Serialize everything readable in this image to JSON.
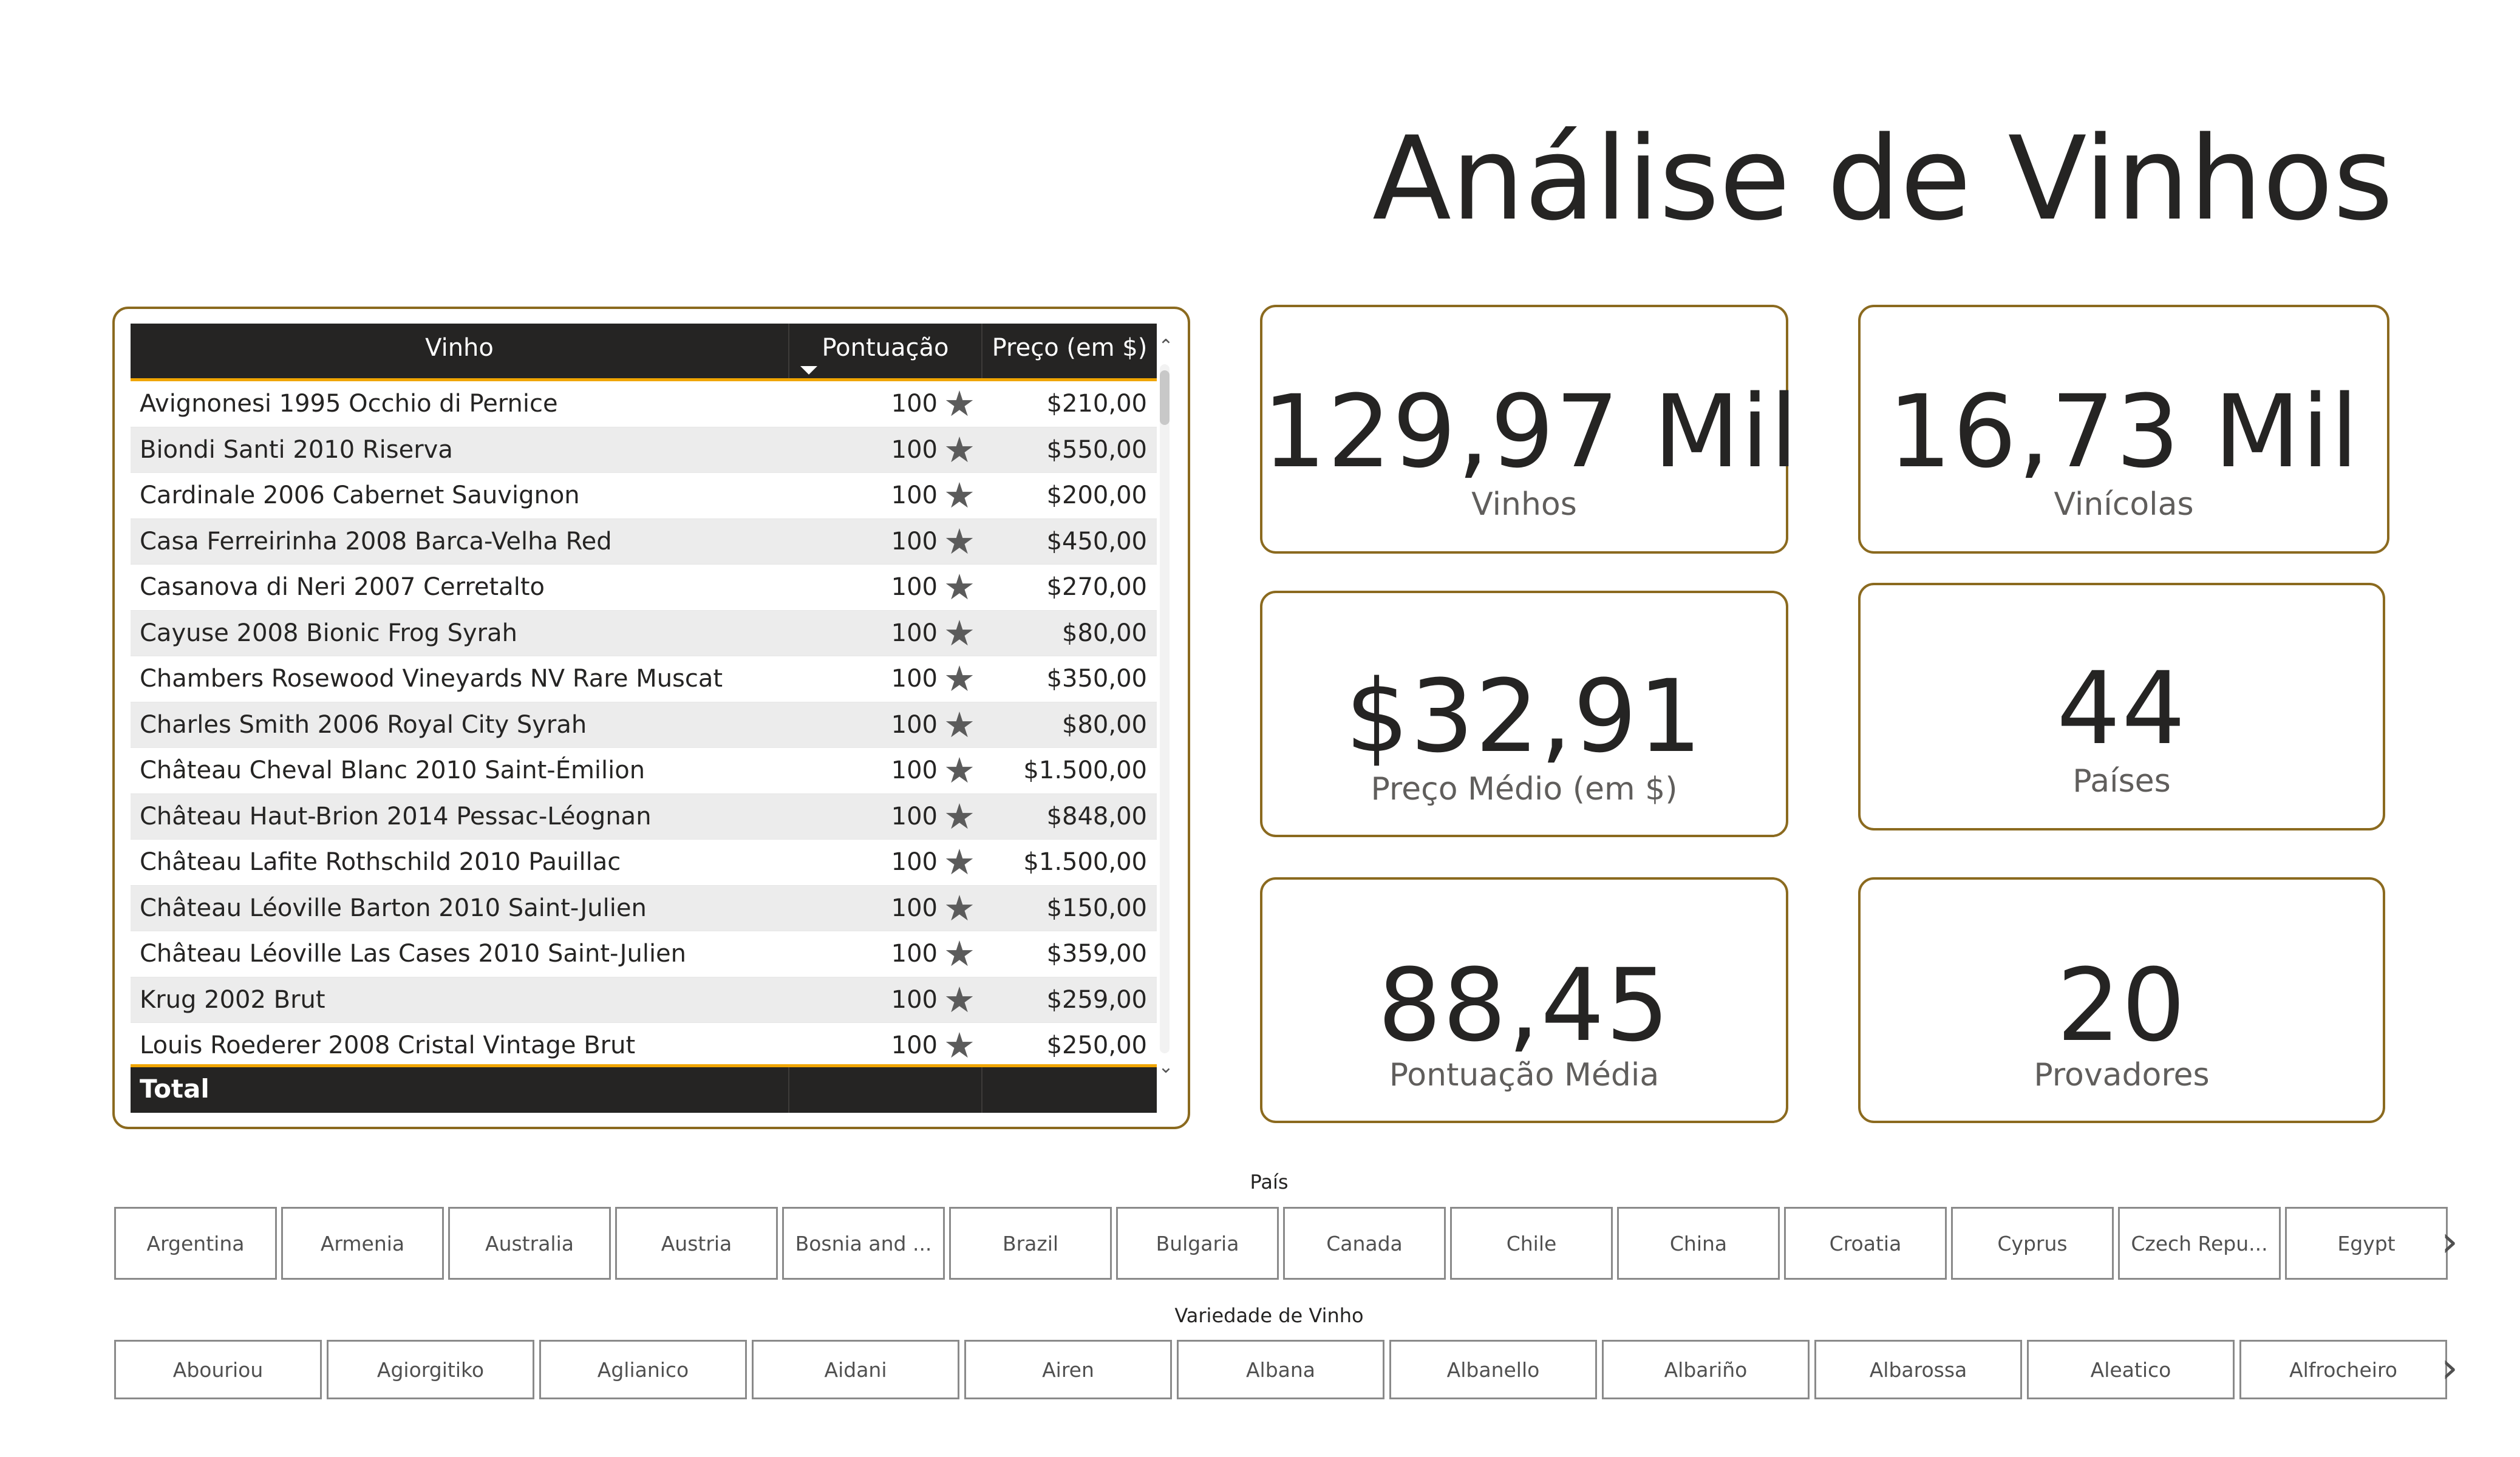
{
  "title": "Análise de Vinhos",
  "table": {
    "headers": {
      "wine": "Vinho",
      "score": "Pontuação",
      "price": "Preço (em $)"
    },
    "rows": [
      {
        "wine": "Avignonesi 1995 Occhio di Pernice",
        "score": "100",
        "price": "$210,00"
      },
      {
        "wine": "Biondi Santi 2010 Riserva",
        "score": "100",
        "price": "$550,00"
      },
      {
        "wine": "Cardinale 2006 Cabernet Sauvignon",
        "score": "100",
        "price": "$200,00"
      },
      {
        "wine": "Casa Ferreirinha 2008 Barca-Velha Red",
        "score": "100",
        "price": "$450,00"
      },
      {
        "wine": "Casanova di Neri 2007 Cerretalto",
        "score": "100",
        "price": "$270,00"
      },
      {
        "wine": "Cayuse 2008 Bionic Frog Syrah",
        "score": "100",
        "price": "$80,00"
      },
      {
        "wine": "Chambers Rosewood Vineyards NV Rare Muscat",
        "score": "100",
        "price": "$350,00"
      },
      {
        "wine": "Charles Smith 2006 Royal City Syrah",
        "score": "100",
        "price": "$80,00"
      },
      {
        "wine": "Château Cheval Blanc 2010 Saint-Émilion",
        "score": "100",
        "price": "$1.500,00"
      },
      {
        "wine": "Château Haut-Brion 2014 Pessac-Léognan",
        "score": "100",
        "price": "$848,00"
      },
      {
        "wine": "Château Lafite Rothschild 2010 Pauillac",
        "score": "100",
        "price": "$1.500,00"
      },
      {
        "wine": "Château Léoville Barton 2010 Saint-Julien",
        "score": "100",
        "price": "$150,00"
      },
      {
        "wine": "Château Léoville Las Cases 2010 Saint-Julien",
        "score": "100",
        "price": "$359,00"
      },
      {
        "wine": "Krug 2002 Brut",
        "score": "100",
        "price": "$259,00"
      },
      {
        "wine": "Louis Roederer 2008 Cristal Vintage Brut",
        "score": "100",
        "price": "$250,00"
      }
    ],
    "total_label": "Total",
    "row_icon": "star-icon"
  },
  "kpis": {
    "wines": {
      "value": "129,97 Mil",
      "label": "Vinhos"
    },
    "wineries": {
      "value": "16,73 Mil",
      "label": "Vinícolas"
    },
    "avg_price": {
      "value": "$32,91",
      "label": "Preço Médio (em $)"
    },
    "countries": {
      "value": "44",
      "label": "Países"
    },
    "avg_score": {
      "value": "88,45",
      "label": "Pontuação Média"
    },
    "tasters": {
      "value": "20",
      "label": "Provadores"
    }
  },
  "slicers": {
    "country": {
      "title": "País",
      "items": [
        "Argentina",
        "Armenia",
        "Australia",
        "Austria",
        "Bosnia and ...",
        "Brazil",
        "Bulgaria",
        "Canada",
        "Chile",
        "China",
        "Croatia",
        "Cyprus",
        "Czech Repu...",
        "Egypt"
      ]
    },
    "variety": {
      "title": "Variedade de Vinho",
      "items": [
        "Abouriou",
        "Agiorgitiko",
        "Aglianico",
        "Aidani",
        "Airen",
        "Albana",
        "Albanello",
        "Albariño",
        "Albarossa",
        "Aleatico",
        "Alfrocheiro"
      ]
    }
  },
  "colors": {
    "card_border": "#8b6a1f",
    "header_bg": "#252423",
    "accent": "#f0a500"
  }
}
